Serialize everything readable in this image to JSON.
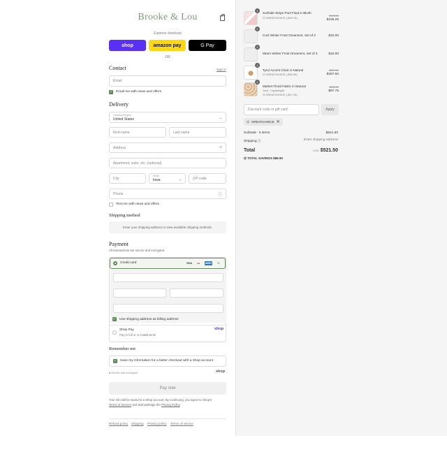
{
  "brand": {
    "logo": "Brooke & Lou"
  },
  "express": {
    "label": "Express checkout",
    "or": "OR",
    "shop": "shop",
    "amazon": "amazon pay",
    "gpay": "G Pay"
  },
  "contact": {
    "title": "Contact",
    "sign_in": "Sign in",
    "email_placeholder": "Email",
    "newsletter": "Email me with news and offers"
  },
  "delivery": {
    "title": "Delivery",
    "country_label": "Country/Region",
    "country_value": "United States",
    "first_name": "First name",
    "last_name": "Last name",
    "address": "Address",
    "apartment": "Apartment, suite, etc. (optional)",
    "city": "City",
    "state_label": "State",
    "state_value": "Iowa",
    "zip": "ZIP code",
    "phone": "Phone",
    "text_offers": "Text me with news and offers"
  },
  "shipping_method": {
    "title": "Shipping method",
    "message": "Enter your shipping address to view available shipping methods."
  },
  "payment": {
    "title": "Payment",
    "subtitle": "All transactions are secure and encrypted.",
    "credit_card": "Credit card",
    "cards": [
      "VISA",
      "MC",
      "AMEX",
      "+4"
    ],
    "billing_same": "Use shipping address as billing address",
    "shop_pay": "Shop Pay",
    "shop_pay_sub": "Pay in full or in installments",
    "shop_logo": "shop"
  },
  "remember": {
    "title": "Remember me",
    "save_info": "Save my information for a faster checkout with a Shop account",
    "secure": "Secure and encrypted",
    "shop_logo": "shop"
  },
  "pay_now": "Pay now",
  "legal": {
    "line1": "Your info will be saved to a Shop account. By continuing, you agree to Shop's",
    "terms": "Terms of Service",
    "mid": "and acknowledge the",
    "privacy": "Privacy Policy",
    "end": "."
  },
  "footer": {
    "links": [
      "Refund policy",
      "Shipping",
      "Privacy policy",
      "Terms of service"
    ]
  },
  "cart": {
    "items": [
      {
        "qty": "1",
        "name": "Surfside Stripe Pool Float in Blush",
        "discount": "GREATCHOICE (-$16.75)",
        "original": "$123.00",
        "price": "$106.25"
      },
      {
        "qty": "1",
        "name": "Cool Winter Frost Ornament, Set of 3",
        "discount": "",
        "original": "",
        "price": "$10.00"
      },
      {
        "qty": "1",
        "name": "Warm Winter Frost Ornament, Set of 3",
        "discount": "",
        "original": "",
        "price": "$10.00"
      },
      {
        "qty": "1",
        "name": "Tyrol Accent Chair in Natural",
        "discount": "GREATCHOICE (-$52.50)",
        "original": "$350.00",
        "price": "$297.50"
      },
      {
        "qty": "1",
        "name": "Market Floral Fabric in Natural",
        "variant": "Yard · Lightweight",
        "discount": "GREATCHOICE (-$17.25)",
        "original": "$115.00",
        "price": "$97.75"
      }
    ],
    "discount_placeholder": "Discount code or gift card",
    "apply": "Apply",
    "applied_code": "GREATCHOICE",
    "subtotal_label": "Subtotal · 5 items",
    "subtotal": "$521.50",
    "shipping_label": "Shipping",
    "shipping_value": "Enter shipping address",
    "total_label": "Total",
    "currency": "USD",
    "total": "$521.50",
    "savings_label": "TOTAL SAVINGS",
    "savings": "$86.50"
  }
}
